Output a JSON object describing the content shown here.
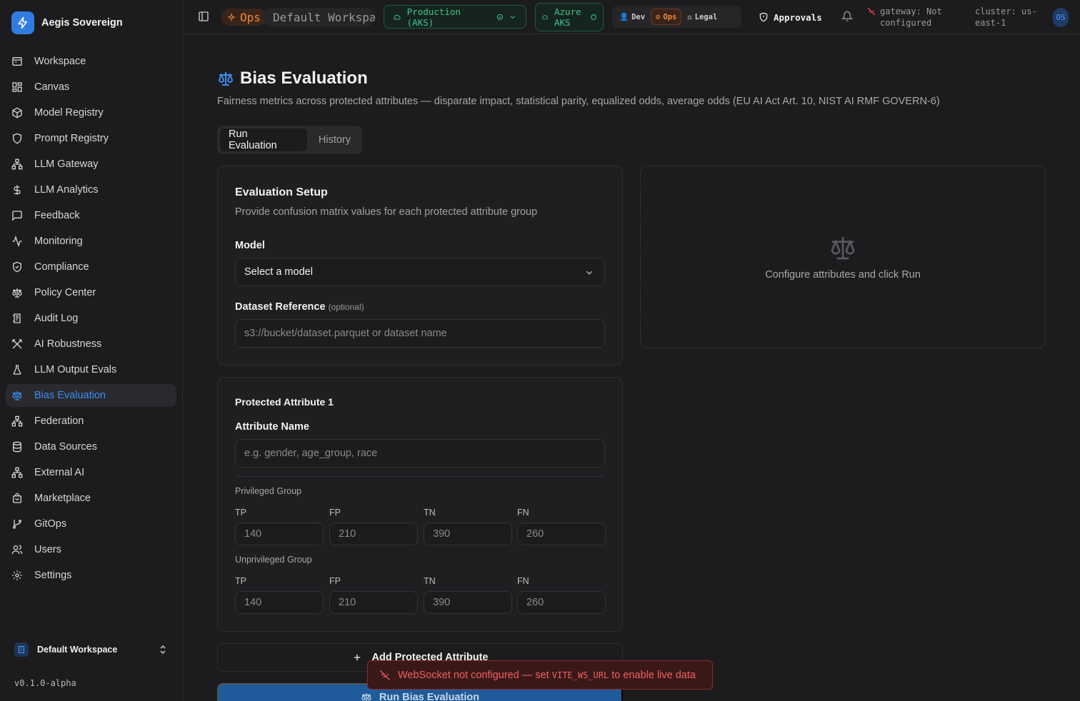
{
  "app": {
    "name": "Aegis Sovereign",
    "version": "v0.1.0-alpha"
  },
  "sidebar": {
    "items": [
      {
        "label": "Workspace",
        "icon": "workspace-icon"
      },
      {
        "label": "Canvas",
        "icon": "canvas-icon"
      },
      {
        "label": "Model Registry",
        "icon": "cube-icon"
      },
      {
        "label": "Prompt Registry",
        "icon": "shield-icon"
      },
      {
        "label": "LLM Gateway",
        "icon": "network-icon"
      },
      {
        "label": "LLM Analytics",
        "icon": "dollar-icon"
      },
      {
        "label": "Feedback",
        "icon": "message-icon"
      },
      {
        "label": "Monitoring",
        "icon": "activity-icon"
      },
      {
        "label": "Compliance",
        "icon": "shield-check-icon"
      },
      {
        "label": "Policy Center",
        "icon": "scale-icon"
      },
      {
        "label": "Audit Log",
        "icon": "log-icon"
      },
      {
        "label": "AI Robustness",
        "icon": "swords-icon"
      },
      {
        "label": "LLM Output Evals",
        "icon": "flask-icon"
      },
      {
        "label": "Bias Evaluation",
        "icon": "scale-icon"
      },
      {
        "label": "Federation",
        "icon": "network-icon"
      },
      {
        "label": "Data Sources",
        "icon": "database-icon"
      },
      {
        "label": "External AI",
        "icon": "network-icon"
      },
      {
        "label": "Marketplace",
        "icon": "bag-icon"
      },
      {
        "label": "GitOps",
        "icon": "git-branch-icon"
      },
      {
        "label": "Users",
        "icon": "users-icon"
      },
      {
        "label": "Settings",
        "icon": "gear-icon"
      }
    ],
    "active_index": 13,
    "workspace_switcher": "Default Workspace"
  },
  "topbar": {
    "ops_badge": "Ops",
    "workspace": "Default Workspa...",
    "environment": "Production (AKS)",
    "cloud_line1": "Azure",
    "cloud_line2": "AKS",
    "roles": [
      "Dev",
      "Ops",
      "Legal"
    ],
    "active_role": "Ops",
    "approvals": "Approvals",
    "gateway_line1": "gateway: Not",
    "gateway_line2": "configured",
    "cluster_line1": "cluster: us-",
    "cluster_line2": "east-1",
    "avatar": "OS"
  },
  "page": {
    "title": "Bias Evaluation",
    "subtitle": "Fairness metrics across protected attributes — disparate impact, statistical parity, equalized odds, average odds (EU AI Act Art. 10, NIST AI RMF GOVERN-6)",
    "tabs": [
      "Run Evaluation",
      "History"
    ]
  },
  "setup": {
    "title": "Evaluation Setup",
    "description": "Provide confusion matrix values for each protected attribute group",
    "model_label": "Model",
    "model_value": "Select a model",
    "dataset_label": "Dataset Reference",
    "dataset_optional": "(optional)",
    "dataset_placeholder": "s3://bucket/dataset.parquet or dataset name"
  },
  "attribute": {
    "title": "Protected Attribute 1",
    "name_label": "Attribute Name",
    "name_placeholder": "e.g. gender, age_group, race",
    "privileged_label": "Privileged Group",
    "unprivileged_label": "Unprivileged Group",
    "metric_labels": [
      "TP",
      "FP",
      "TN",
      "FN"
    ],
    "privileged_values": [
      "140",
      "210",
      "390",
      "260"
    ],
    "unprivileged_values": [
      "140",
      "210",
      "390",
      "260"
    ]
  },
  "empty_state": "Configure attributes and click Run",
  "actions": {
    "add_attribute": "Add Protected Attribute",
    "run": "Run Bias Evaluation"
  },
  "toast": {
    "prefix": "WebSocket not configured — set",
    "code": "VITE_WS_URL",
    "suffix": "to enable live data"
  },
  "colors": {
    "accent": "#3b8cf0",
    "ops": "#f08a3c",
    "env": "#3fc58f",
    "error": "#f06060"
  }
}
